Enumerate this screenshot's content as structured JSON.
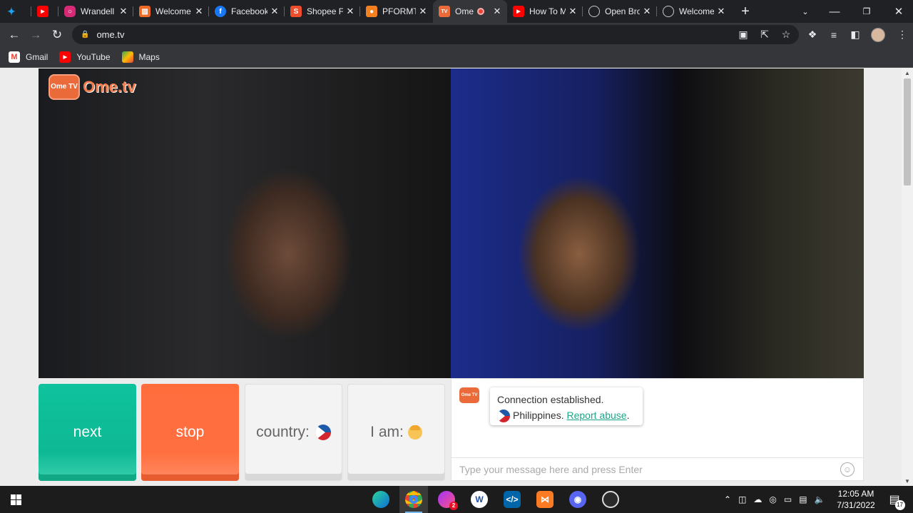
{
  "tabs": [
    {
      "title": "",
      "icon": "twitter-icon",
      "color": "#1da1f2"
    },
    {
      "title": "",
      "icon": "youtube-icon",
      "color": "#ff0000"
    },
    {
      "title": "Wrandell",
      "icon": "instagram-icon",
      "color": "#d62976"
    },
    {
      "title": "Welcome",
      "icon": "app-icon",
      "color": "#f06a25"
    },
    {
      "title": "Facebook",
      "icon": "facebook-icon",
      "color": "#1877f2"
    },
    {
      "title": "Shopee F",
      "icon": "shopee-icon",
      "color": "#ee4d2d"
    },
    {
      "title": "PFORMT",
      "icon": "classroom-icon",
      "color": "#f5801f"
    },
    {
      "title": "Ome",
      "icon": "ometv-icon",
      "color": "#ea6a3a",
      "active": true
    },
    {
      "title": "How To M",
      "icon": "youtube-icon",
      "color": "#ff0000"
    },
    {
      "title": "Open Bro",
      "icon": "globe-icon",
      "color": "#9aa0a6"
    },
    {
      "title": "Welcome",
      "icon": "globe-icon",
      "color": "#9aa0a6"
    }
  ],
  "address": {
    "url": "ome.tv"
  },
  "bookmarks": [
    {
      "label": "Gmail",
      "icon": "gmail-icon"
    },
    {
      "label": "YouTube",
      "icon": "youtube-icon"
    },
    {
      "label": "Maps",
      "icon": "maps-icon"
    }
  ],
  "site": {
    "logo_text": "Ome.tv",
    "logo_badge": "Ome TV",
    "buttons": {
      "next": "next",
      "stop": "stop",
      "country": "country:",
      "iam": "I am:"
    },
    "chat": {
      "message": "Connection established.",
      "country": "Philippines.",
      "report": "Report abuse",
      "report_suffix": ".",
      "placeholder": "Type your message here and press Enter"
    },
    "colors": {
      "next": "#0fc29d",
      "stop": "#ff6d3d",
      "link": "#1ba78a"
    }
  },
  "taskbar": {
    "time": "12:05 AM",
    "date": "7/31/2022",
    "notification_count": "17",
    "discord_badge": "2"
  }
}
